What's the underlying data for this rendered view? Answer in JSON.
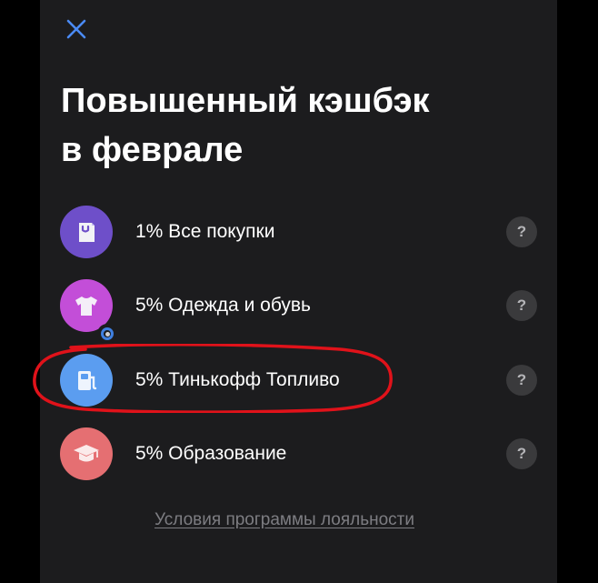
{
  "header": {
    "close_icon": "close-icon",
    "title_line1": "Повышенный кэшбэк",
    "title_line2": "в феврале"
  },
  "cashback_items": [
    {
      "label": "1% Все покупки",
      "icon": "shopping-bag-icon",
      "icon_color": "#6e4fc9",
      "help": "?"
    },
    {
      "label": "5% Одежда и обувь",
      "icon": "tshirt-icon",
      "icon_color": "#c34ed8",
      "help": "?",
      "has_badge": true
    },
    {
      "label": "5% Тинькофф Топливо",
      "icon": "fuel-pump-icon",
      "icon_color": "#5b9df0",
      "help": "?",
      "highlighted": true
    },
    {
      "label": "5% Образование",
      "icon": "graduation-cap-icon",
      "icon_color": "#e56f72",
      "help": "?"
    }
  ],
  "footer": {
    "link_text": "Условия программы лояльности"
  },
  "colors": {
    "panel_bg": "#1c1c1e",
    "accent_blue": "#3f7fe0",
    "highlight_marker": "#e0121a"
  }
}
